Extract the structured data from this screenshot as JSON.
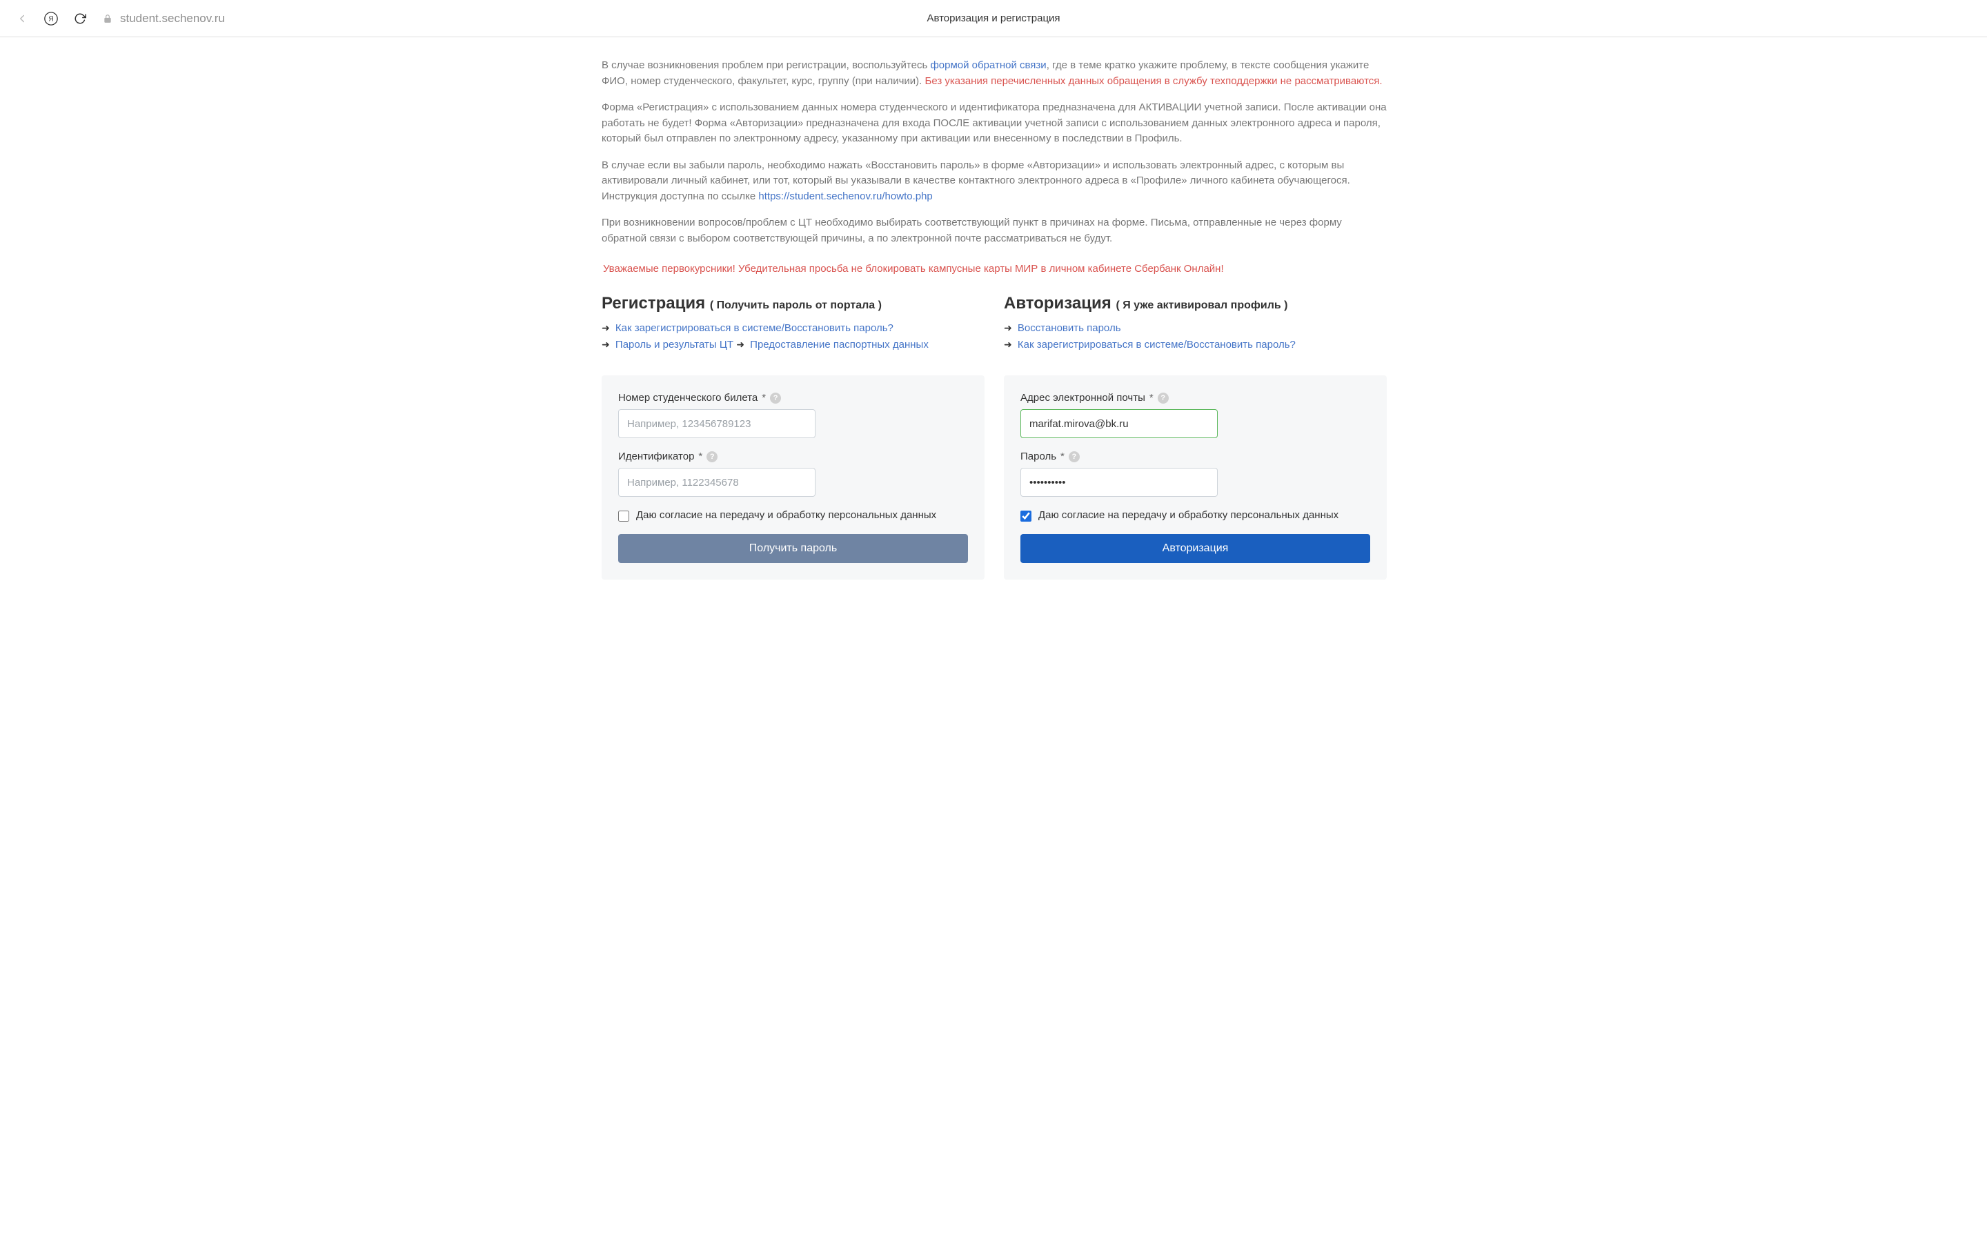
{
  "browser": {
    "url_display": "student.sechenov.ru",
    "tab_title": "Авторизация и регистрация"
  },
  "intro": {
    "p1_a": "В случае возникновения проблем при регистрации, воспользуйтесь ",
    "p1_link": "формой обратной связи",
    "p1_b": ", где в теме кратко укажите проблему, в тексте сообщения укажите ФИО, номер студенческого, факультет, курс, группу (при наличии). ",
    "p1_red": "Без указания перечисленных данных обращения в службу техподдержки не рассматриваются.",
    "p2": "Форма «Регистрация» с использованием данных номера студенческого и идентификатора предназначена для АКТИВАЦИИ учетной записи. После активации она работать не будет! Форма «Авторизации» предназначена для входа ПОСЛЕ активации учетной записи с использованием данных электронного адреса и пароля, который был отправлен по электронному адресу, указанному при активации или внесенному в последствии в Профиль.",
    "p3_a": "В случае если вы забыли пароль, необходимо нажать «Восстановить пароль» в форме «Авторизации» и использовать электронный адрес, с которым вы активировали личный кабинет, или тот, который вы указывали в качестве контактного электронного адреса в «Профиле» личного кабинета обучающегося. Инструкция доступна по ссылке ",
    "p3_link": "https://student.sechenov.ru/howto.php",
    "p4": "При возникновении вопросов/проблем с ЦТ необходимо выбирать соответствующий пункт в причинах на форме. Письма, отправленные не через форму обратной связи с выбором соответствующей причины, а по электронной почте рассматриваться не будут.",
    "notice": "Уважаемые первокурсники! Убедительная просьба не блокировать кампусные карты МИР в личном кабинете Сбербанк Онлайн!"
  },
  "registration": {
    "title": "Регистрация",
    "subtitle": "Получить пароль от портала",
    "links": {
      "howto": "Как зарегистрироваться в системе/Восстановить пароль?",
      "ct": "Пароль и результаты ЦТ",
      "passport": "Предоставление паспортных данных"
    },
    "fields": {
      "student_id_label": "Номер студенческого билета",
      "student_id_placeholder": "Например, 123456789123",
      "student_id_value": "",
      "ident_label": "Идентификатор",
      "ident_placeholder": "Например, 1122345678",
      "ident_value": "",
      "consent_label": "Даю согласие на передачу и обработку персональных данных",
      "submit": "Получить пароль"
    }
  },
  "auth": {
    "title": "Авторизация",
    "subtitle": "Я уже активировал профиль",
    "links": {
      "restore": "Восстановить пароль",
      "howto": "Как зарегистрироваться в системе/Восстановить пароль?"
    },
    "fields": {
      "email_label": "Адрес электронной почты",
      "email_value": "marifat.mirova@bk.ru",
      "password_label": "Пароль",
      "password_value": "••••••••••",
      "consent_label": "Даю согласие на передачу и обработку персональных данных",
      "submit": "Авторизация"
    }
  }
}
